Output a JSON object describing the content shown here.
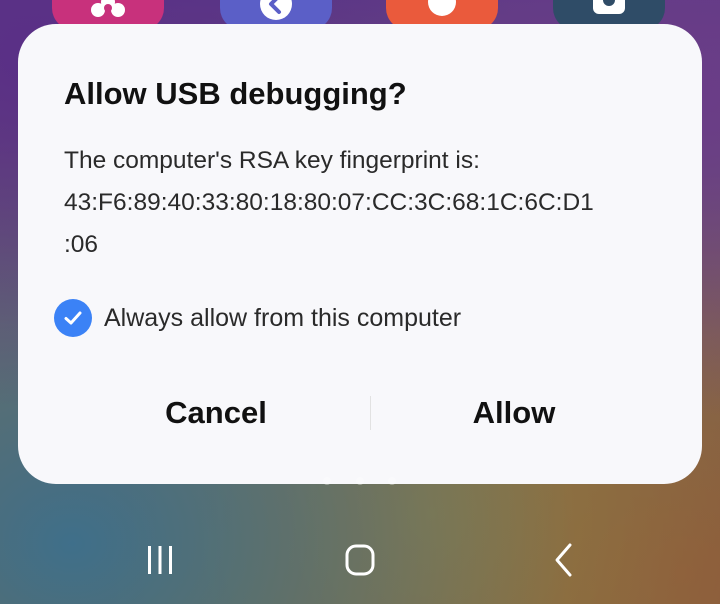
{
  "dialog": {
    "title": "Allow USB debugging?",
    "message_line1": "The computer's RSA key fingerprint is:",
    "fingerprint_line1": "43:F6:89:40:33:80:18:80:07:CC:3C:68:1C:6C:D1",
    "fingerprint_line2": ":06",
    "checkbox_label": "Always allow from this computer",
    "checkbox_checked": true,
    "cancel_label": "Cancel",
    "allow_label": "Allow"
  },
  "background_apps": [
    {
      "icon": "flower-icon",
      "color": "#c8317c"
    },
    {
      "icon": "back-arrow-icon",
      "color": "#5b5fc7"
    },
    {
      "icon": "circle-icon",
      "color": "#ea5a3c"
    },
    {
      "icon": "gear-icon",
      "color": "#2f4c67"
    }
  ],
  "navigation_bar": {
    "buttons": [
      "recent-apps-icon",
      "home-icon",
      "back-icon"
    ]
  },
  "colors": {
    "checkbox_accent": "#3b82f6",
    "dialog_background": "#f8f8fb"
  }
}
